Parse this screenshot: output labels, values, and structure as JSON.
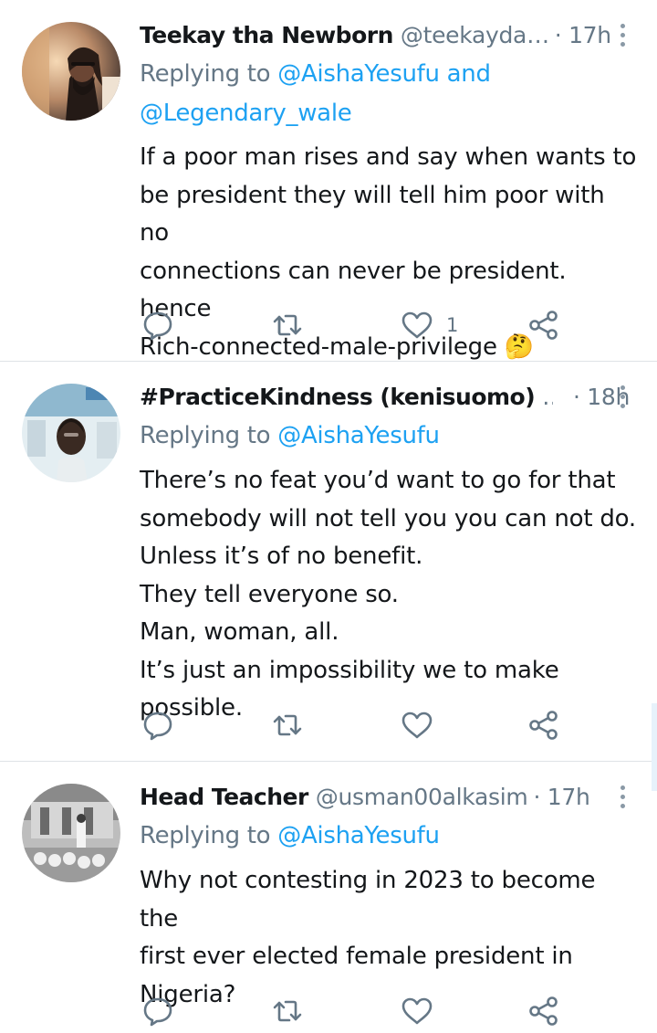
{
  "tweets": [
    {
      "name": "Teekay tha Newborn",
      "handle": "@teekayda…",
      "time": "· 17h",
      "replying_prefix": "Replying to ",
      "replying_mentions": "@AishaYesufu and",
      "replying_line2": "@Legendary_wale",
      "lines": [
        "If a poor man rises and say when wants to",
        "be president they will tell him poor with no",
        "connections can never be president. hence",
        "Rich-connected-male-privilege 🤔"
      ],
      "like_count": "1",
      "avatar_icon": "profile-photo"
    },
    {
      "name": "#PracticeKindness (kenisuomo)",
      "handle": "…",
      "time": "· 18h",
      "replying_prefix": "Replying to ",
      "replying_mentions": "@AishaYesufu",
      "lines": [
        "There’s no feat you’d want to go for that",
        "somebody will not tell you  you can not do.",
        "Unless it’s of no benefit.",
        "They tell everyone so.",
        "Man, woman, all.",
        "It’s just an impossibility we to make possible."
      ],
      "like_count": "",
      "avatar_icon": "profile-photo"
    },
    {
      "name": "Head Teacher",
      "handle": "@usman00alkasim",
      "time": "· 17h",
      "replying_prefix": "Replying to ",
      "replying_mentions": "@AishaYesufu",
      "lines": [
        "Why not contesting in 2023 to become the",
        "first ever elected female president in",
        "Nigeria?"
      ],
      "like_count": "",
      "avatar_icon": "profile-photo"
    }
  ],
  "colors": {
    "mention": "#1da1f2",
    "secondary_text": "#657786",
    "icon": "#657786",
    "divider": "#dfe3e6"
  },
  "icons": [
    "reply-icon",
    "retweet-icon",
    "like-icon",
    "share-icon",
    "more-options-icon"
  ]
}
